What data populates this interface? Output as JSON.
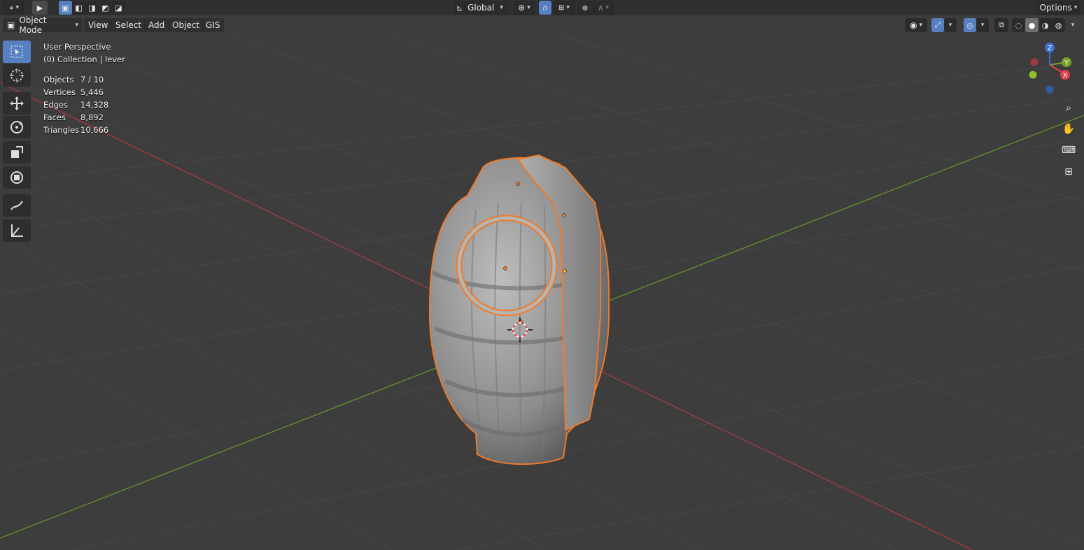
{
  "header": {
    "orientation_label": "Global",
    "options_label": "Options"
  },
  "view_header": {
    "mode_label": "Object Mode",
    "menus": [
      "View",
      "Select",
      "Add",
      "Object",
      "GIS"
    ]
  },
  "overlay": {
    "perspective": "User Perspective",
    "collection": "(0) Collection | lever",
    "stats": [
      {
        "label": "Objects",
        "value": "7 / 10"
      },
      {
        "label": "Vertices",
        "value": "5,446"
      },
      {
        "label": "Edges",
        "value": "14,328"
      },
      {
        "label": "Faces",
        "value": "8,892"
      },
      {
        "label": "Triangles",
        "value": "10,666"
      }
    ]
  },
  "gizmo": {
    "z": "Z",
    "y": "Y",
    "x": "X"
  },
  "colors": {
    "accent": "#5680c2",
    "selection": "#f07a2a",
    "x_axis": "#b8404a",
    "y_axis": "#6a9a2a"
  },
  "tools": [
    "select-box-icon",
    "cursor-icon",
    "move-icon",
    "rotate-icon",
    "scale-icon",
    "transform-icon",
    "annotate-icon",
    "measure-icon"
  ]
}
